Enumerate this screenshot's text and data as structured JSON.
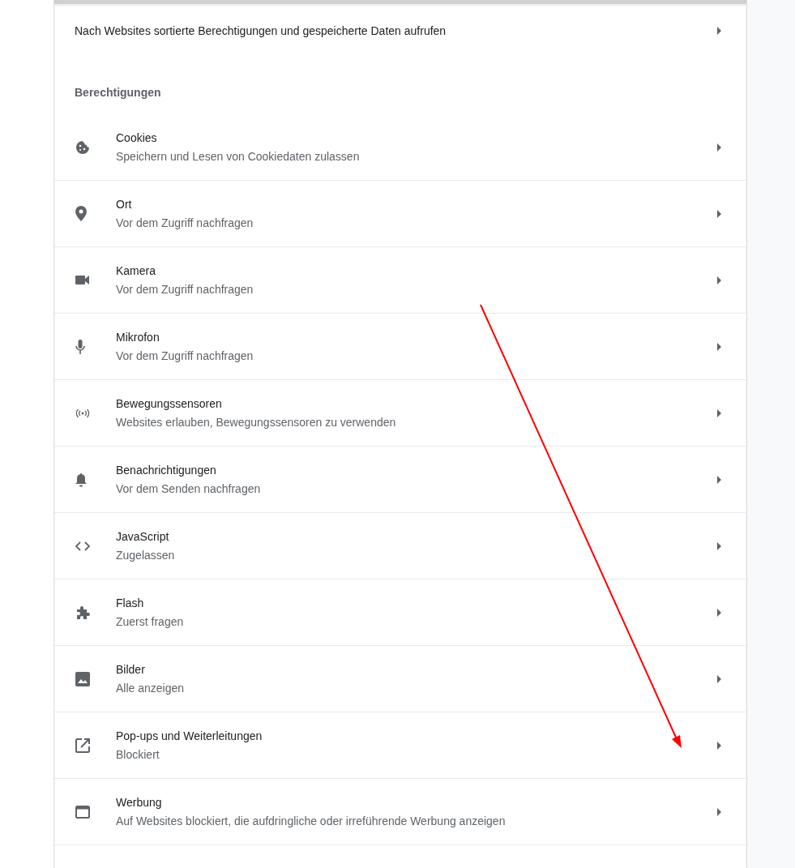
{
  "site_data_link": {
    "label": "Nach Websites sortierte Berechtigungen und gespeicherte Daten aufrufen"
  },
  "section_title": "Berechtigungen",
  "permissions": [
    {
      "title": "Cookies",
      "subtitle": "Speichern und Lesen von Cookiedaten zulassen"
    },
    {
      "title": "Ort",
      "subtitle": "Vor dem Zugriff nachfragen"
    },
    {
      "title": "Kamera",
      "subtitle": "Vor dem Zugriff nachfragen"
    },
    {
      "title": "Mikrofon",
      "subtitle": "Vor dem Zugriff nachfragen"
    },
    {
      "title": "Bewegungssensoren",
      "subtitle": "Websites erlauben, Bewegungssensoren zu verwenden"
    },
    {
      "title": "Benachrichtigungen",
      "subtitle": "Vor dem Senden nachfragen"
    },
    {
      "title": "JavaScript",
      "subtitle": "Zugelassen"
    },
    {
      "title": "Flash",
      "subtitle": "Zuerst fragen"
    },
    {
      "title": "Bilder",
      "subtitle": "Alle anzeigen"
    },
    {
      "title": "Pop-ups und Weiterleitungen",
      "subtitle": "Blockiert"
    },
    {
      "title": "Werbung",
      "subtitle": "Auf Websites blockiert, die aufdringliche oder irreführende Werbung anzeigen"
    }
  ]
}
